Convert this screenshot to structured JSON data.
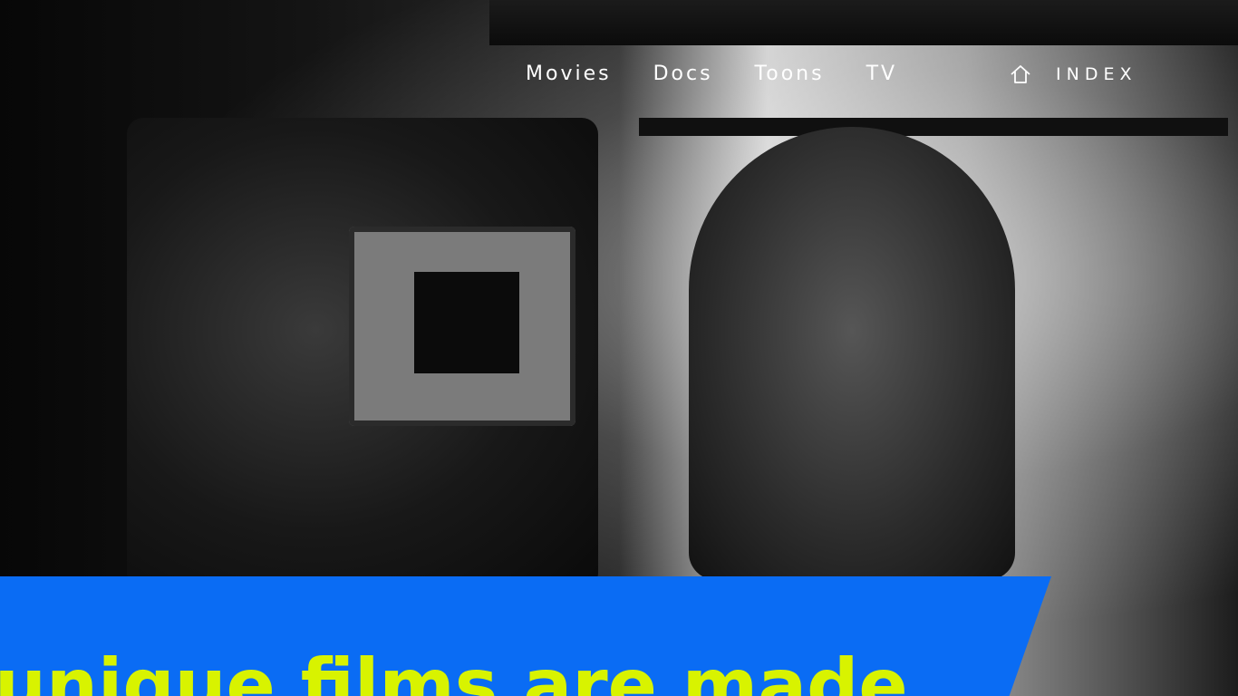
{
  "nav": {
    "items": [
      {
        "label": "Movies"
      },
      {
        "label": "Docs"
      },
      {
        "label": "Toons"
      },
      {
        "label": "TV"
      }
    ],
    "index_label": "INDEX",
    "index_icon": "home-icon"
  },
  "hero": {
    "headline": "unique films are made"
  },
  "colors": {
    "banner_bg": "#0a6cf4",
    "headline": "#d8f300",
    "nav_text": "#ffffff"
  }
}
